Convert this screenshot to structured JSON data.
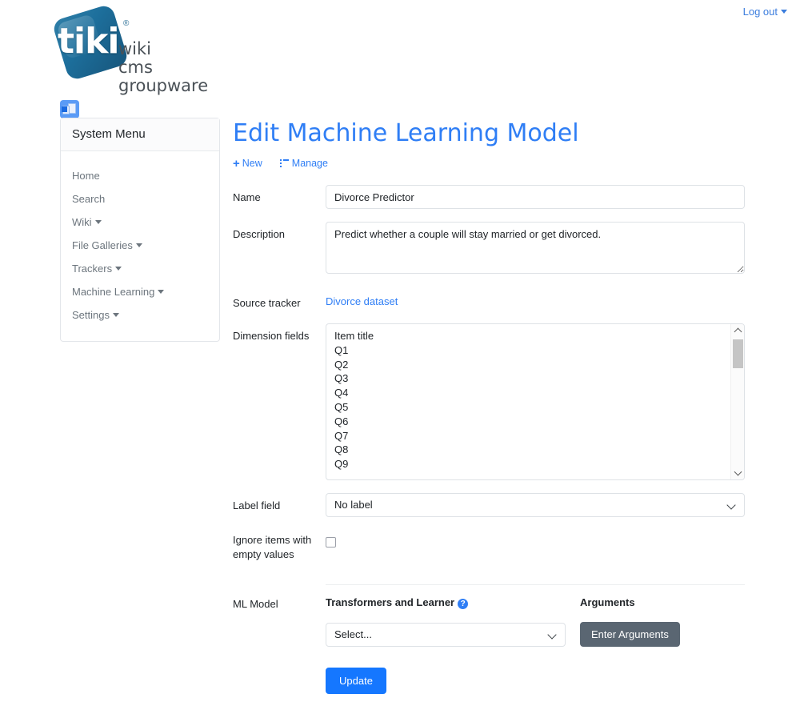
{
  "topbar": {
    "logout_label": "Log out"
  },
  "logo": {
    "word": "tiki",
    "registered": "®",
    "tagline_line1": "wiki",
    "tagline_line2": "cms",
    "tagline_line3": "groupware"
  },
  "module_toggle": {
    "icon": "assign-module-icon"
  },
  "sidebar": {
    "header": "System Menu",
    "items": [
      {
        "label": "Home",
        "has_caret": false
      },
      {
        "label": "Search",
        "has_caret": false
      },
      {
        "label": "Wiki",
        "has_caret": true
      },
      {
        "label": "File Galleries",
        "has_caret": true
      },
      {
        "label": "Trackers",
        "has_caret": true
      },
      {
        "label": "Machine Learning",
        "has_caret": true
      },
      {
        "label": "Settings",
        "has_caret": true
      }
    ]
  },
  "main": {
    "title": "Edit Machine Learning Model",
    "actions": [
      {
        "label": "New",
        "icon": "plus-icon"
      },
      {
        "label": "Manage",
        "icon": "list-icon"
      }
    ],
    "form": {
      "name": {
        "label": "Name",
        "value": "Divorce Predictor",
        "placeholder": ""
      },
      "description": {
        "label": "Description",
        "value": "Predict whether a couple will stay married or get divorced.",
        "placeholder": ""
      },
      "source_tracker": {
        "label": "Source tracker",
        "value": "Divorce dataset"
      },
      "dimension_fields": {
        "label": "Dimension fields",
        "options": [
          "Item title",
          "Q1",
          "Q2",
          "Q3",
          "Q4",
          "Q5",
          "Q6",
          "Q7",
          "Q8",
          "Q9"
        ]
      },
      "label_field": {
        "label": "Label field",
        "value": "No label"
      },
      "ignore_empty": {
        "label": "Ignore items with empty values",
        "checked": false
      },
      "ml_model": {
        "label": "ML Model",
        "transformers_heading": "Transformers and Learner",
        "arguments_heading": "Arguments",
        "select_value": "Select...",
        "arguments_button": "Enter Arguments"
      },
      "submit": {
        "label": "Update"
      }
    }
  },
  "colors": {
    "primary_blue": "#1577ff",
    "title_blue": "#2f7ef5",
    "link_blue": "#3b7ddd",
    "gray_button": "#5a6672",
    "border": "#dee2e6"
  }
}
